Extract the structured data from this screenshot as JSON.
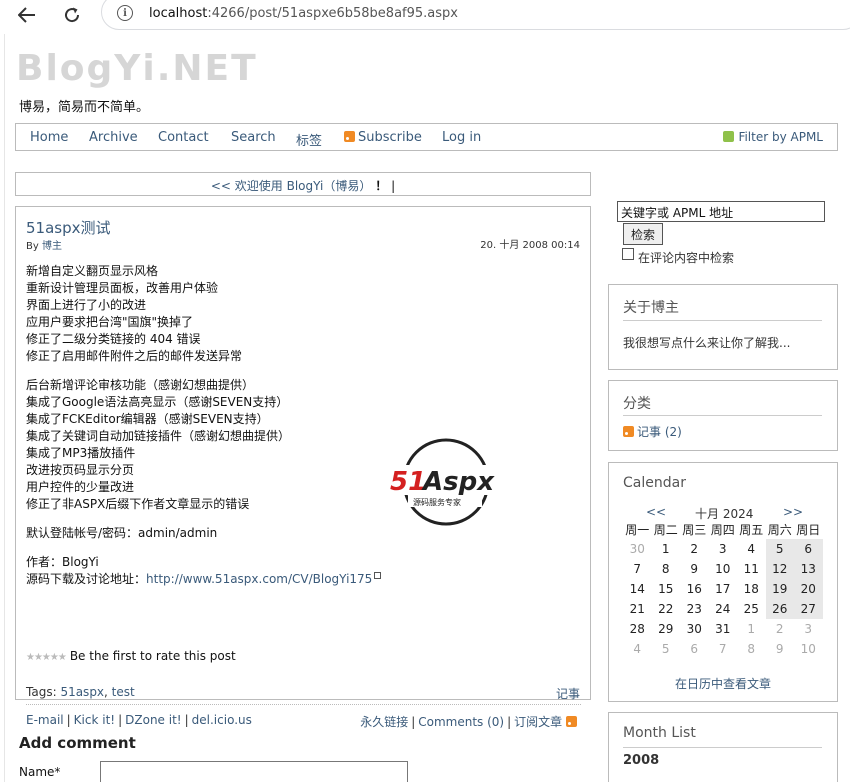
{
  "browser": {
    "url_host": "localhost",
    "url_rest": ":4266/post/51aspxe6b58be8af95.aspx"
  },
  "site": {
    "title": "BlogYi.NET",
    "subtitle": "博易，简易而不简单。"
  },
  "menu": {
    "items": [
      "Home",
      "Archive",
      "Contact",
      "Search",
      "标签"
    ],
    "subscribe": "Subscribe",
    "login": "Log in",
    "filter": "Filter by APML"
  },
  "welcome": {
    "text": "<< 欢迎使用 BlogYi（博易）",
    "bang": "！",
    "bar": "|"
  },
  "post": {
    "title": "51aspx测试",
    "by_label": "By",
    "author": "博主",
    "date": "20. 十月 2008 00:14",
    "para1": [
      "新增自定义翻页显示风格",
      "重新设计管理员面板，改善用户体验",
      "界面上进行了小的改进",
      "应用户要求把台湾\"国旗\"换掉了",
      "修正了二级分类链接的 404 错误",
      "修正了启用邮件附件之后的邮件发送异常"
    ],
    "para2": [
      "后台新增评论审核功能（感谢幻想曲提供）",
      "集成了Google语法高亮显示（感谢SEVEN支持）",
      "集成了FCKEditor编辑器（感谢SEVEN支持）",
      "集成了关键词自动加链接插件（感谢幻想曲提供）",
      "集成了MP3播放插件",
      "改进按页码显示分页",
      "用户控件的少量改进",
      "修正了非ASPX后缀下作者文章显示的错误"
    ],
    "login_info": "默认登陆帐号/密码：admin/admin",
    "author_line": "作者：BlogYi",
    "source_label": "源码下载及讨论地址：",
    "source_url": "http://www.51aspx.com/CV/BlogYi175",
    "logo_text": "51Aspx",
    "logo_sub": "源码服务专家",
    "rating": "Be the first to rate this post",
    "tags_label": "Tags:",
    "tags": [
      "51aspx",
      "test"
    ],
    "category": "记事",
    "share": [
      "E-mail",
      "Kick it!",
      "DZone it!",
      "del.icio.us"
    ],
    "permalink": "永久链接",
    "comments": "Comments (0)",
    "subscribe": "订阅文章"
  },
  "comment_form": {
    "title": "Add comment",
    "name_label": "Name*"
  },
  "sidebar": {
    "search_placeholder": "关键字或 APML 地址",
    "search_button": "检索",
    "search_comments": "在评论内容中检索",
    "about_title": "关于博主",
    "about_text": "我很想写点什么来让你了解我...",
    "categories_title": "分类",
    "category_item": "记事 (2)",
    "calendar_title": "Calendar",
    "calendar_prev": "<<",
    "calendar_month": "十月 2024",
    "calendar_next": ">>",
    "weekdays": [
      "周一",
      "周二",
      "周三",
      "周四",
      "周五",
      "周六",
      "周日"
    ],
    "weeks": [
      [
        "30",
        "1",
        "2",
        "3",
        "4",
        "5",
        "6"
      ],
      [
        "7",
        "8",
        "9",
        "10",
        "11",
        "12",
        "13"
      ],
      [
        "14",
        "15",
        "16",
        "17",
        "18",
        "19",
        "20"
      ],
      [
        "21",
        "22",
        "23",
        "24",
        "25",
        "26",
        "27"
      ],
      [
        "28",
        "29",
        "30",
        "31",
        "1",
        "2",
        "3"
      ],
      [
        "4",
        "5",
        "6",
        "7",
        "8",
        "9",
        "10"
      ]
    ],
    "calendar_link": "在日历中查看文章",
    "monthlist_title": "Month List",
    "monthlist_year": "2008"
  }
}
